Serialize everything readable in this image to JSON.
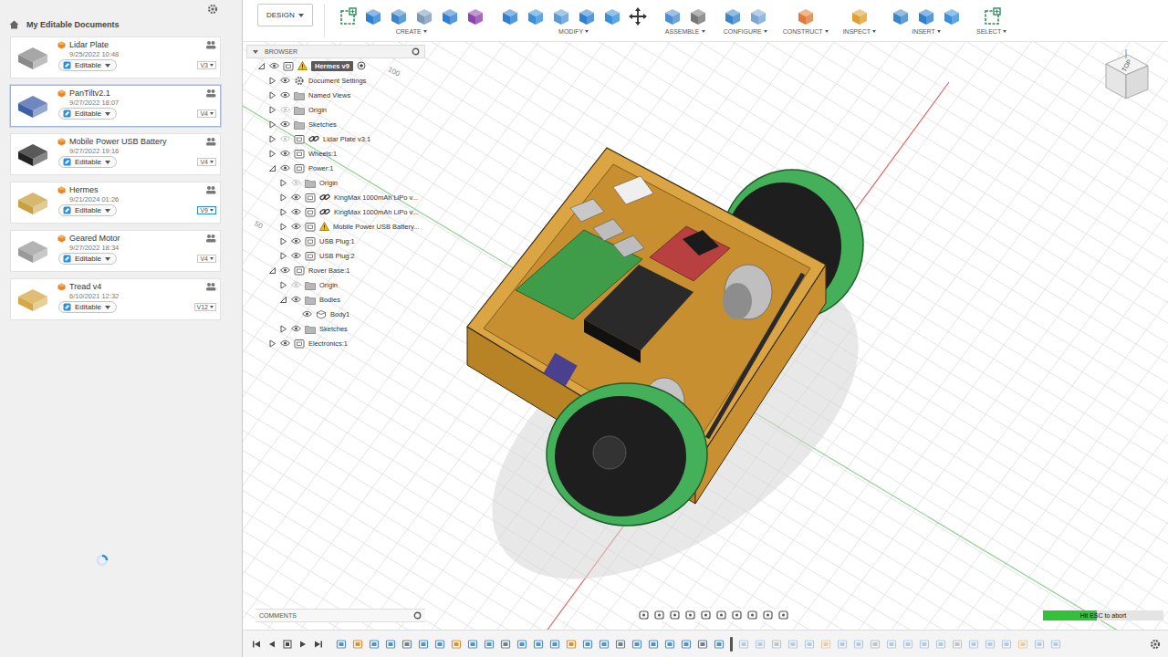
{
  "sidebar": {
    "title": "My Editable Documents",
    "loading": true,
    "documents": [
      {
        "name": "Lidar Plate",
        "date": "9/25/2022 10:48",
        "status": "Editable",
        "version": "V3",
        "selected": false,
        "open": false
      },
      {
        "name": "PanTiltv2.1",
        "date": "9/27/2022 18:07",
        "status": "Editable",
        "version": "V4",
        "selected": true,
        "open": false
      },
      {
        "name": "Mobile Power USB Battery",
        "date": "9/27/2022 19:16",
        "status": "Editable",
        "version": "V4",
        "selected": false,
        "open": false
      },
      {
        "name": "Hermes",
        "date": "9/21/2024 01:26",
        "status": "Editable",
        "version": "V9",
        "selected": false,
        "open": true
      },
      {
        "name": "Geared Motor",
        "date": "9/27/2022 18:34",
        "status": "Editable",
        "version": "V4",
        "selected": false,
        "open": false
      },
      {
        "name": "Tread v4",
        "date": "6/10/2021 12:32",
        "status": "Editable",
        "version": "V12",
        "selected": false,
        "open": false
      }
    ]
  },
  "toolbar": {
    "workspace": "DESIGN",
    "groups": [
      {
        "label": "CREATE"
      },
      {
        "label": "MODIFY"
      },
      {
        "label": "ASSEMBLE"
      },
      {
        "label": "CONFIGURE"
      },
      {
        "label": "CONSTRUCT"
      },
      {
        "label": "INSPECT"
      },
      {
        "label": "INSERT"
      },
      {
        "label": "SELECT"
      }
    ]
  },
  "browser": {
    "title": "BROWSER",
    "tree": [
      {
        "label": "Hermes v9",
        "kind": "component",
        "expanded": true,
        "visible": true,
        "linked": false,
        "warning": true,
        "active": true,
        "children": [
          {
            "label": "Document Settings",
            "kind": "settings",
            "expanded": false,
            "visible": true,
            "linked": false,
            "warning": false,
            "active": false
          },
          {
            "label": "Named Views",
            "kind": "folder",
            "expanded": false,
            "visible": true,
            "linked": false,
            "warning": false,
            "active": false
          },
          {
            "label": "Origin",
            "kind": "folder",
            "expanded": false,
            "visible": false,
            "linked": false,
            "warning": false,
            "active": false
          },
          {
            "label": "Sketches",
            "kind": "folder",
            "expanded": false,
            "visible": true,
            "linked": false,
            "warning": false,
            "active": false
          },
          {
            "label": "Lidar Plate v3:1",
            "kind": "component",
            "expanded": false,
            "visible": false,
            "linked": true,
            "warning": false,
            "active": false
          },
          {
            "label": "Wheels:1",
            "kind": "component",
            "expanded": false,
            "visible": true,
            "linked": false,
            "warning": false,
            "active": false
          },
          {
            "label": "Power:1",
            "kind": "component",
            "expanded": true,
            "visible": true,
            "linked": false,
            "warning": false,
            "active": false,
            "children": [
              {
                "label": "Origin",
                "kind": "folder",
                "expanded": false,
                "visible": false,
                "linked": false,
                "warning": false,
                "active": false
              },
              {
                "label": "KingMax 1000mAh LiPo v...",
                "kind": "component",
                "expanded": false,
                "visible": true,
                "linked": true,
                "warning": false,
                "active": false
              },
              {
                "label": "KingMax 1000mAh LiPo v...",
                "kind": "component",
                "expanded": false,
                "visible": true,
                "linked": true,
                "warning": false,
                "active": false
              },
              {
                "label": "Mobile Power USB Battery...",
                "kind": "component",
                "expanded": false,
                "visible": true,
                "linked": false,
                "warning": true,
                "active": false
              },
              {
                "label": "USB Plug:1",
                "kind": "component",
                "expanded": false,
                "visible": true,
                "linked": false,
                "warning": false,
                "active": false
              },
              {
                "label": "USB Plug:2",
                "kind": "component",
                "expanded": false,
                "visible": true,
                "linked": false,
                "warning": false,
                "active": false
              }
            ]
          },
          {
            "label": "Rover Base:1",
            "kind": "component",
            "expanded": true,
            "visible": true,
            "linked": false,
            "warning": false,
            "active": false,
            "children": [
              {
                "label": "Origin",
                "kind": "folder",
                "expanded": false,
                "visible": false,
                "linked": false,
                "warning": false,
                "active": false
              },
              {
                "label": "Bodies",
                "kind": "folder",
                "expanded": true,
                "visible": true,
                "linked": false,
                "warning": false,
                "active": false,
                "children": [
                  {
                    "label": "Body1",
                    "kind": "body",
                    "expanded": false,
                    "visible": true,
                    "linked": false,
                    "warning": false,
                    "active": false
                  }
                ]
              },
              {
                "label": "Sketches",
                "kind": "folder",
                "expanded": false,
                "visible": true,
                "linked": false,
                "warning": false,
                "active": false
              }
            ]
          },
          {
            "label": "Electronics:1",
            "kind": "component",
            "expanded": false,
            "visible": true,
            "linked": false,
            "warning": false,
            "active": false
          }
        ]
      }
    ]
  },
  "viewport": {
    "axis_labels": [
      "100",
      "50"
    ],
    "view_cube": "TOP"
  },
  "comments": {
    "title": "COMMENTS"
  },
  "progress": {
    "label": "Hit ESC to abort",
    "level": 0.45
  },
  "timeline": {
    "features": [
      {
        "kind": "component",
        "rolled_back": false
      },
      {
        "kind": "sketch",
        "rolled_back": false
      },
      {
        "kind": "component",
        "rolled_back": false
      },
      {
        "kind": "component",
        "rolled_back": false
      },
      {
        "kind": "joint",
        "rolled_back": false
      },
      {
        "kind": "component",
        "rolled_back": false
      },
      {
        "kind": "component",
        "rolled_back": false
      },
      {
        "kind": "sketch",
        "rolled_back": false
      },
      {
        "kind": "component",
        "rolled_back": false
      },
      {
        "kind": "component",
        "rolled_back": false
      },
      {
        "kind": "joint",
        "rolled_back": false
      },
      {
        "kind": "component",
        "rolled_back": false
      },
      {
        "kind": "component",
        "rolled_back": false
      },
      {
        "kind": "component",
        "rolled_back": false
      },
      {
        "kind": "sketch",
        "rolled_back": false
      },
      {
        "kind": "component",
        "rolled_back": false
      },
      {
        "kind": "component",
        "rolled_back": false
      },
      {
        "kind": "joint",
        "rolled_back": false
      },
      {
        "kind": "component",
        "rolled_back": false
      },
      {
        "kind": "component",
        "rolled_back": false
      },
      {
        "kind": "component",
        "rolled_back": false
      },
      {
        "kind": "component",
        "rolled_back": false
      },
      {
        "kind": "joint",
        "rolled_back": false
      },
      {
        "kind": "component",
        "rolled_back": false
      },
      {
        "kind": "component",
        "rolled_back": true
      },
      {
        "kind": "component",
        "rolled_back": true
      },
      {
        "kind": "joint",
        "rolled_back": true
      },
      {
        "kind": "component",
        "rolled_back": true
      },
      {
        "kind": "component",
        "rolled_back": true
      },
      {
        "kind": "sketch",
        "rolled_back": true
      },
      {
        "kind": "component",
        "rolled_back": true
      },
      {
        "kind": "component",
        "rolled_back": true
      },
      {
        "kind": "joint",
        "rolled_back": true
      },
      {
        "kind": "component",
        "rolled_back": true
      },
      {
        "kind": "component",
        "rolled_back": true
      },
      {
        "kind": "component",
        "rolled_back": true
      },
      {
        "kind": "component",
        "rolled_back": true
      },
      {
        "kind": "joint",
        "rolled_back": true
      },
      {
        "kind": "component",
        "rolled_back": true
      },
      {
        "kind": "component",
        "rolled_back": true
      },
      {
        "kind": "component",
        "rolled_back": true
      },
      {
        "kind": "sketch",
        "rolled_back": true
      },
      {
        "kind": "component",
        "rolled_back": true
      },
      {
        "kind": "component",
        "rolled_back": true
      }
    ]
  }
}
